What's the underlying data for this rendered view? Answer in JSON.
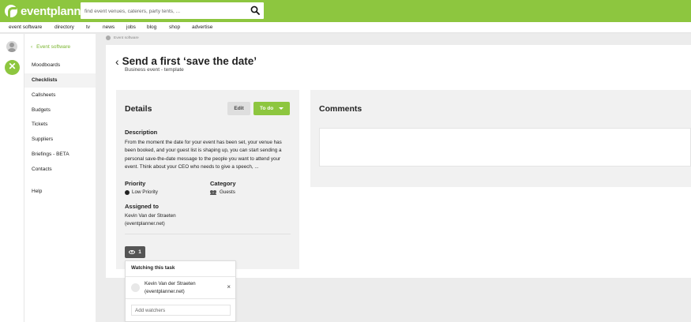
{
  "header": {
    "logo_text": "eventplanner",
    "search_placeholder": "find event venues, caterers, party tents, ...",
    "brand_color": "#8dc63f"
  },
  "nav": {
    "items": [
      "event software",
      "directory",
      "tv",
      "news",
      "jobs",
      "blog",
      "shop",
      "advertise"
    ]
  },
  "sidebar": {
    "back_label": "Event software",
    "items": [
      {
        "label": "Moodboards",
        "active": false
      },
      {
        "label": "Checklists",
        "active": true
      },
      {
        "label": "Callsheets",
        "active": false
      },
      {
        "label": "Budgets",
        "active": false
      },
      {
        "label": "Tickets",
        "active": false
      },
      {
        "label": "Suppliers",
        "active": false
      },
      {
        "label": "Briefings - BETA",
        "active": false
      },
      {
        "label": "Contacts",
        "active": false
      },
      {
        "label": "Help",
        "active": false
      }
    ]
  },
  "breadcrumb": {
    "label": "Event software"
  },
  "page": {
    "title": "Send a first ‘save the date’",
    "subtitle": "Business event - template"
  },
  "details": {
    "heading": "Details",
    "edit_label": "Edit",
    "status_label": "To do",
    "description_heading": "Description",
    "description": "From the moment the date for your event has been set, your venue has been booked, and your guest list is shaping up, you can start sending a personal save-the-date message to the people you want to attend your event. Think about your CEO who needs to give a speech, ...",
    "priority_heading": "Priority",
    "priority_value": "Low Priority",
    "category_heading": "Category",
    "category_value": "Guests",
    "assigned_heading": "Assigned to",
    "assignee_line1": "Kevin Van der Straeten",
    "assignee_line2": "(eventplanner.net)",
    "watch_count": "1"
  },
  "watchers": {
    "heading": "Watching this task",
    "watcher_line1": "Kevin Van der Straeten",
    "watcher_line2": "(eventplanner.net)",
    "remove_glyph": "×",
    "add_placeholder": "Add watchers"
  },
  "comments": {
    "heading": "Comments"
  }
}
